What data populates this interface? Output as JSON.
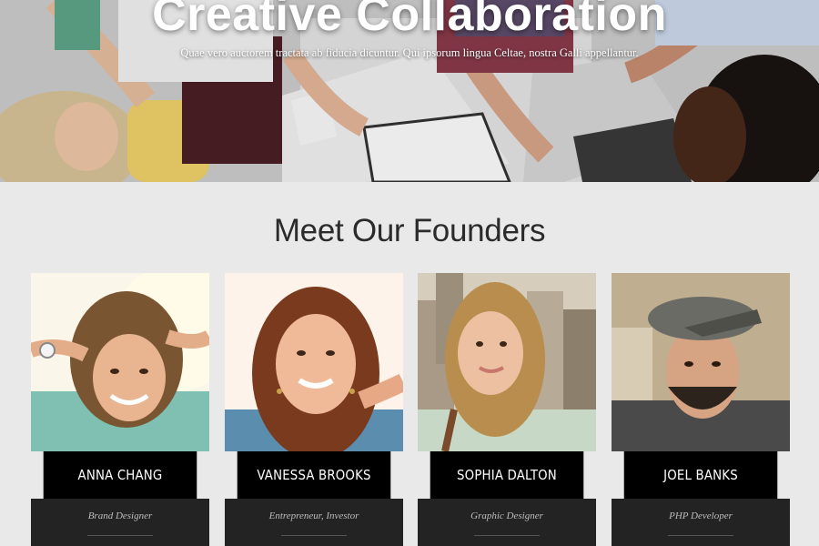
{
  "hero": {
    "title": "Creative Collaboration",
    "subtitle": "Quae vero auctorem tractata ab fiducia dicuntur. Qui ipsorum lingua Celtae, nostra Galli appellantur."
  },
  "section": {
    "title": "Meet Our Founders"
  },
  "founders": [
    {
      "name": "ANNA CHANG",
      "role": "Brand Designer"
    },
    {
      "name": "VANESSA BROOKS",
      "role": "Entrepreneur, Investor"
    },
    {
      "name": "SOPHIA DALTON",
      "role": "Graphic Designer"
    },
    {
      "name": "JOEL BANKS",
      "role": "PHP Developer"
    }
  ],
  "colors": {
    "page_bg": "#e9e9e9",
    "name_bar": "#000000",
    "role_box": "#232323",
    "title_text": "#2b2b2b"
  }
}
